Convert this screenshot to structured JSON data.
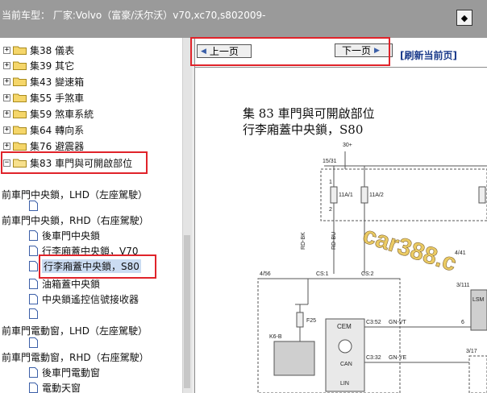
{
  "header": {
    "title": "当前车型：  厂家:Volvo（富豪/沃尔沃）v70,xc70,s802009-",
    "window_button_icon": "restore-icon"
  },
  "tree": {
    "folders": [
      {
        "label": "集38 儀表"
      },
      {
        "label": "集39 其它"
      },
      {
        "label": "集43 變速箱"
      },
      {
        "label": "集55 手煞車"
      },
      {
        "label": "集59 煞車系統"
      },
      {
        "label": "集64 轉向系"
      },
      {
        "label": "集76 避震器"
      },
      {
        "label": "集83 車門與可開啟部位"
      }
    ],
    "items": [
      {
        "label": "前車門中央鎖，LHD（左座駕駛）"
      },
      {
        "label": "前車門中央鎖，RHD（右座駕駛）"
      },
      {
        "label": "後車門中央鎖"
      },
      {
        "label": "行李廂蓋中央鎖，V70"
      },
      {
        "label": "行李廂蓋中央鎖，S80"
      },
      {
        "label": "油箱蓋中央鎖"
      },
      {
        "label": "中央鎖遙控信號接收器"
      },
      {
        "label": "前車門電動窗，LHD（左座駕駛）"
      },
      {
        "label": "前車門電動窗，RHD（右座駕駛）"
      },
      {
        "label": "後車門電動窗"
      },
      {
        "label": "電動天窗"
      }
    ]
  },
  "nav": {
    "prev_label": "上一页",
    "next_label": "下一页",
    "refresh_label": "[刷新当前页]"
  },
  "diagram": {
    "title_line1": "集 83 車門與可開啟部位",
    "title_line2": "行李廂蓋中央鎖，S80",
    "labels": {
      "v30": "30+",
      "bus1531": "15/31",
      "fuse1": "11A/1",
      "fuse2": "11A/2",
      "wire1": "RD-BK",
      "wire2": "RD-BU",
      "conn456": "4/56",
      "cs1": "CS:1",
      "cs2": "CS:2",
      "f25": "F25",
      "k6b": "K6-B",
      "cem": "CEM",
      "can": "CAN",
      "lin": "LIN",
      "c352": "C3:52",
      "gnvt": "GN-VT",
      "c332": "C3:32",
      "gnye": "GN-YE",
      "m3111": "3/111",
      "lsm": "LSM",
      "m441": "4/41",
      "m317": "3/17",
      "n6": "6",
      "n2": "2",
      "n1": "1"
    },
    "watermark": "car388.c"
  }
}
